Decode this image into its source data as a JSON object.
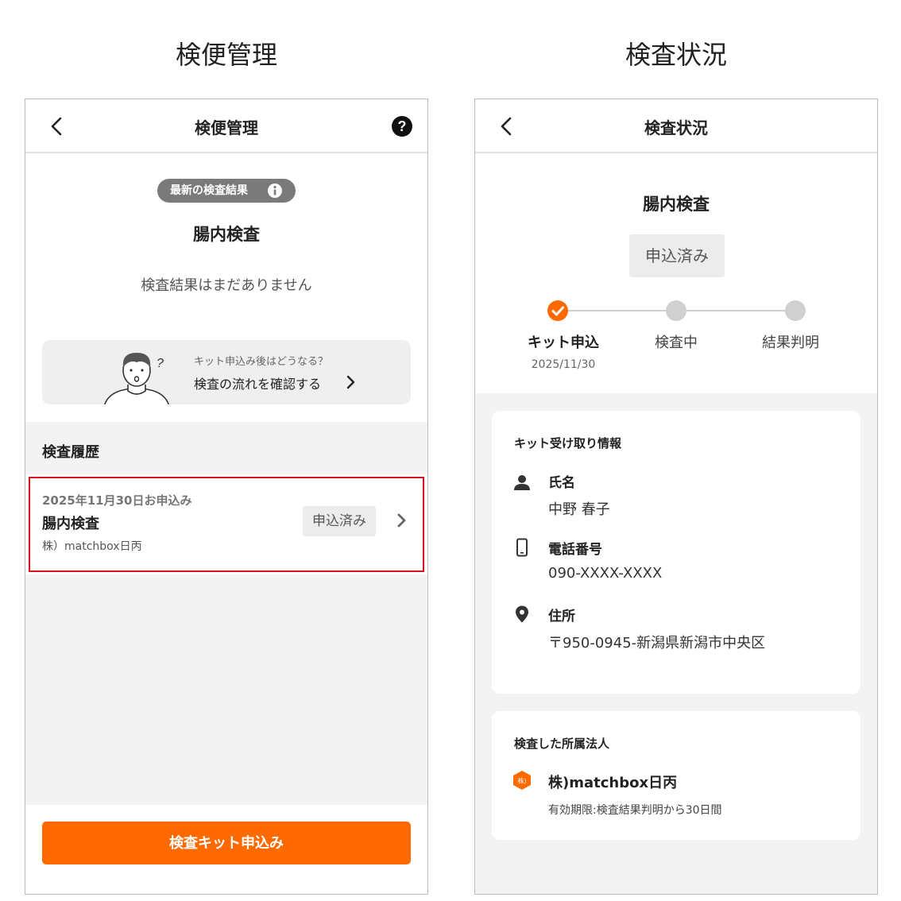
{
  "captions": {
    "left": "検便管理",
    "right": "検査状況"
  },
  "left_screen": {
    "nav": {
      "title": "検便管理"
    },
    "latest_badge": "最新の検査結果",
    "test_name": "腸内検査",
    "no_result_text": "検査結果はまだありません",
    "flow_card": {
      "question": "キット申込み後はどうなる？",
      "link_text": "検査の流れを確認する"
    },
    "history": {
      "title": "検査履歴",
      "items": [
        {
          "date": "2025年11月30日お申込み",
          "name": "腸内検査",
          "corp": "株）matchbox日丙",
          "status": "申込済み"
        }
      ]
    },
    "apply_button": "検査キット申込み"
  },
  "right_screen": {
    "nav": {
      "title": "検査状況"
    },
    "test_name": "腸内検査",
    "status": "申込済み",
    "steps": [
      {
        "label": "キット申込",
        "date": "2025/11/30",
        "done": true
      },
      {
        "label": "検査中",
        "date": "",
        "done": false
      },
      {
        "label": "結果判明",
        "date": "",
        "done": false
      }
    ],
    "kit_card": {
      "title": "キット受け取り情報",
      "name_label": "氏名",
      "name_value": "中野 春子",
      "phone_label": "電話番号",
      "phone_value": "090-XXXX-XXXX",
      "address_label": "住所",
      "address_value": "〒950-0945-新潟県新潟市中央区"
    },
    "corp_card": {
      "title": "検査した所属法人",
      "icon_text": "株)",
      "corp_name": "株)matchbox日丙",
      "validity": "有効期限:検査結果判明から30日間"
    }
  },
  "colors": {
    "accent": "#ff6a00",
    "highlight_border": "#d9111a",
    "badge_gray": "#7a7a7a",
    "background_gray": "#f3f3f3"
  },
  "icons": [
    "back-arrow-icon",
    "help-icon",
    "info-icon",
    "chevron-right-icon",
    "person-icon",
    "phone-icon",
    "location-pin-icon",
    "corp-hexagon-icon",
    "check-icon"
  ]
}
